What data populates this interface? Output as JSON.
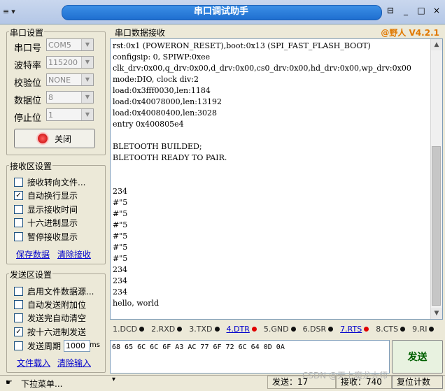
{
  "window": {
    "title": "串口调试助手",
    "menu_glyph": "≡",
    "pin": "⊟",
    "minimize": "_",
    "maximize": "□",
    "close": "×"
  },
  "serial_settings": {
    "title": "串口设置",
    "rows": [
      {
        "label": "串口号",
        "value": "COM5"
      },
      {
        "label": "波特率",
        "value": "115200"
      },
      {
        "label": "校验位",
        "value": "NONE"
      },
      {
        "label": "数据位",
        "value": "8"
      },
      {
        "label": "停止位",
        "value": "1"
      }
    ],
    "close_button": "关闭"
  },
  "receive_settings": {
    "title": "接收区设置",
    "options": [
      {
        "label": "接收转向文件...",
        "checked": false
      },
      {
        "label": "自动换行显示",
        "checked": true
      },
      {
        "label": "显示接收时间",
        "checked": false
      },
      {
        "label": "十六进制显示",
        "checked": false
      },
      {
        "label": "暂停接收显示",
        "checked": false
      }
    ],
    "save_link": "保存数据",
    "clear_link": "清除接收"
  },
  "send_settings": {
    "title": "发送区设置",
    "options": [
      {
        "label": "启用文件数据源...",
        "checked": false
      },
      {
        "label": "自动发送附加位",
        "checked": false
      },
      {
        "label": "发送完自动清空",
        "checked": false
      },
      {
        "label": "按十六进制发送",
        "checked": true
      }
    ],
    "period_label": "发送周期",
    "period_value": "1000",
    "period_unit": "ms",
    "load_link": "文件载入",
    "clear_link": "清除输入"
  },
  "receive_area": {
    "title": "串口数据接收",
    "brand": "@野人 V4.2.1",
    "lines": [
      "rst:0x1 (POWERON_RESET),boot:0x13 (SPI_FAST_FLASH_BOOT)",
      "configsip: 0, SPIWP:0xee",
      "clk_drv:0x00,q_drv:0x00,d_drv:0x00,cs0_drv:0x00,hd_drv:0x00,wp_drv:0x00",
      "mode:DIO, clock div:2",
      "load:0x3fff0030,len:1184",
      "load:0x40078000,len:13192",
      "load:0x40080400,len:3028",
      "entry 0x400805e4",
      "",
      "BLETOOTH BUILDED;",
      "BLETOOTH READY TO PAIR.",
      "",
      "",
      "234",
      "#\"5",
      "#\"5",
      "#\"5",
      "#\"5",
      "#\"5",
      "#\"5",
      "234",
      "234",
      "234",
      "hello, world"
    ]
  },
  "signals": [
    {
      "label": "1.DCD",
      "color": "black",
      "link": false
    },
    {
      "label": "2.RXD",
      "color": "black",
      "link": false
    },
    {
      "label": "3.TXD",
      "color": "black",
      "link": false
    },
    {
      "label": "4.DTR",
      "color": "red",
      "link": true
    },
    {
      "label": "5.GND",
      "color": "black",
      "link": false
    },
    {
      "label": "6.DSR",
      "color": "black",
      "link": false
    },
    {
      "label": "7.RTS",
      "color": "red",
      "link": true
    },
    {
      "label": "8.CTS",
      "color": "black",
      "link": false
    },
    {
      "label": "9.RI",
      "color": "black",
      "link": false
    }
  ],
  "send_area": {
    "content": "68 65 6C 6C 6F A3 AC 77 6F 72 6C 64 0D 0A",
    "send_button": "发送"
  },
  "statusbar": {
    "dropdown_label": "下拉菜单...",
    "sent_label": "发送：17",
    "recv_label": "接收：740",
    "reset_label": "复位计数",
    "watermark": "CSDN @无上魔龙大师"
  },
  "colors": {
    "brand": "#e07800",
    "link": "#0000cc",
    "send_text": "#006000",
    "title_pill": "#1f6fd0"
  }
}
